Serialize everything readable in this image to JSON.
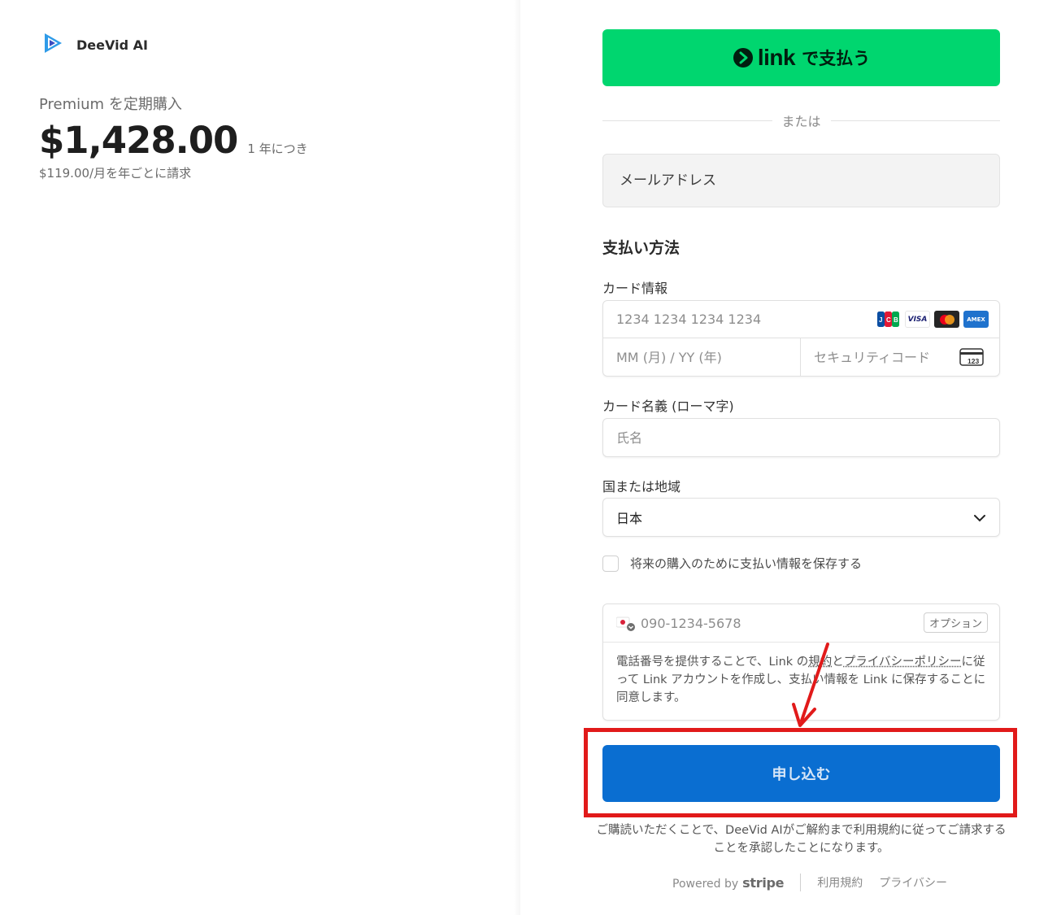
{
  "brand": {
    "name": "DeeVid AI"
  },
  "summary": {
    "product": "Premium を定期購入",
    "price": "$1,428.00",
    "period": "1 年につき",
    "billing_note": "$119.00/月を年ごとに請求"
  },
  "link_button": {
    "word": "link",
    "label": "で支払う",
    "color": "#00d66f"
  },
  "or_text": "または",
  "email": {
    "placeholder": "メールアドレス"
  },
  "payment": {
    "section_title": "支払い方法",
    "card_label": "カード情報",
    "card_number_placeholder": "1234 1234 1234 1234",
    "card_brands": [
      "jcb-icon",
      "visa-icon",
      "mastercard-icon",
      "amex-icon"
    ],
    "expiry_placeholder": "MM (月) / YY (年)",
    "cvc_placeholder": "セキュリティコード",
    "cvc_icon_text": "123",
    "name_label": "カード名義 (ローマ字)",
    "name_placeholder": "氏名",
    "country_label": "国または地域",
    "country_value": "日本"
  },
  "save_info": {
    "label": "将来の購入のために支払い情報を保存する",
    "checked": false
  },
  "phone": {
    "placeholder": "090-1234-5678",
    "optional_badge": "オプション",
    "consent_before": "電話番号を提供することで、Link の",
    "consent_terms": "規約",
    "consent_and": "と",
    "consent_privacy": "プライバシーポリシー",
    "consent_after": "に従って Link アカウントを作成し、支払い情報を Link に保存することに同意します。"
  },
  "submit": {
    "label": "申し込む",
    "color": "#0a6ed1"
  },
  "terms_note": "ご購読いただくことで、DeeVid AIがご解約まで利用規約に従ってご請求することを承認したことになります。",
  "footer": {
    "powered_by": "Powered by",
    "stripe": "stripe",
    "terms": "利用規約",
    "privacy": "プライバシー"
  },
  "annotation": {
    "highlight_color": "#e11a1a"
  }
}
